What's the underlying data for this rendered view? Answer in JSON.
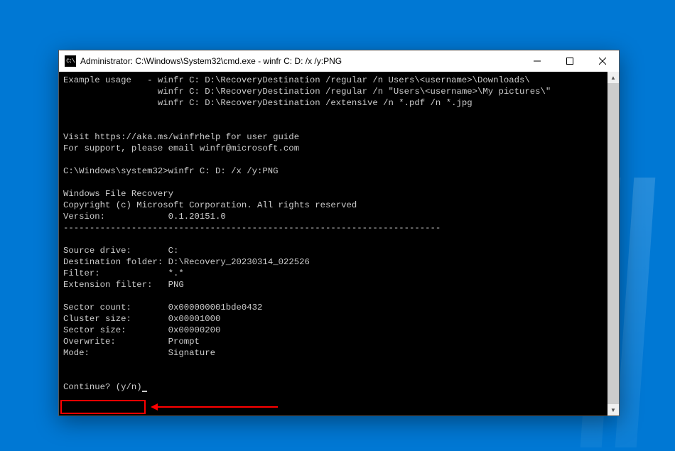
{
  "window": {
    "title": "Administrator: C:\\Windows\\System32\\cmd.exe - winfr  C: D: /x /y:PNG",
    "icon_label": "C:\\"
  },
  "terminal": {
    "example_label": "Example usage   - ",
    "example1": "winfr C: D:\\RecoveryDestination /regular /n Users\\<username>\\Downloads\\",
    "example2": "winfr C: D:\\RecoveryDestination /regular /n \"Users\\<username>\\My pictures\\\"",
    "example3": "winfr C: D:\\RecoveryDestination /extensive /n *.pdf /n *.jpg",
    "help_line": "Visit https://aka.ms/winfrhelp for user guide",
    "support_line": "For support, please email winfr@microsoft.com",
    "prompt_path": "C:\\Windows\\system32>",
    "command": "winfr C: D: /x /y:PNG",
    "app_name": "Windows File Recovery",
    "copyright": "Copyright (c) Microsoft Corporation. All rights reserved",
    "version_label": "Version:",
    "version": "0.1.20151.0",
    "separator": "------------------------------------------------------------------------",
    "source_label": "Source drive:",
    "source_value": "C:",
    "dest_label": "Destination folder:",
    "dest_value": "D:\\Recovery_20230314_022526",
    "filter_label": "Filter:",
    "filter_value": "*.*",
    "ext_label": "Extension filter:",
    "ext_value": "PNG",
    "sector_count_label": "Sector count:",
    "sector_count_value": "0x000000001bde0432",
    "cluster_label": "Cluster size:",
    "cluster_value": "0x00001000",
    "sector_size_label": "Sector size:",
    "sector_size_value": "0x00000200",
    "overwrite_label": "Overwrite:",
    "overwrite_value": "Prompt",
    "mode_label": "Mode:",
    "mode_value": "Signature",
    "continue_prompt": "Continue? (y/n)"
  }
}
